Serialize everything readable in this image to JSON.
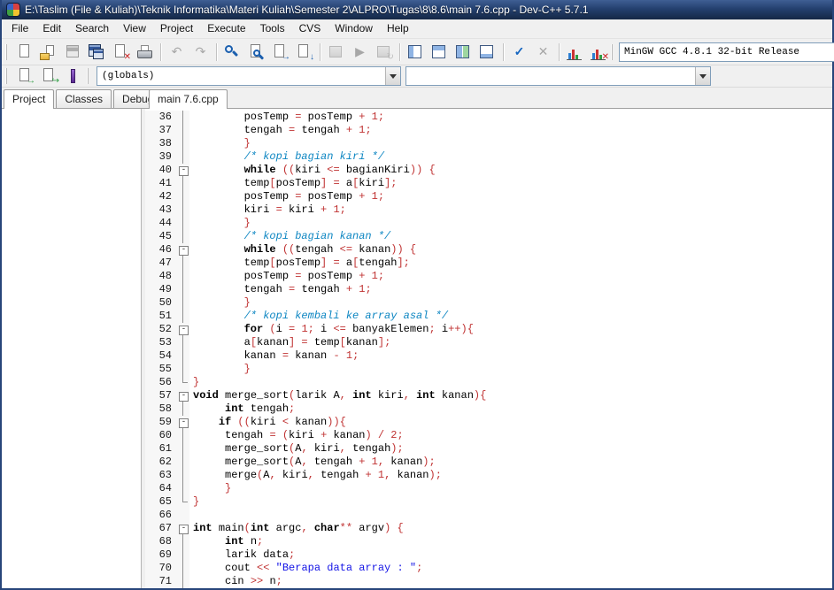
{
  "window": {
    "title": "E:\\Taslim (File & Kuliah)\\Teknik Informatika\\Materi Kuliah\\Semester 2\\ALPRO\\Tugas\\8\\8.6\\main 7.6.cpp - Dev-C++ 5.7.1"
  },
  "menu": {
    "items": [
      "File",
      "Edit",
      "Search",
      "View",
      "Project",
      "Execute",
      "Tools",
      "CVS",
      "Window",
      "Help"
    ]
  },
  "toolbars": {
    "main": {
      "groups": [
        [
          {
            "name": "new-source-file",
            "icon": "new"
          },
          {
            "name": "open-file",
            "icon": "open"
          },
          {
            "name": "save",
            "icon": "save",
            "disabled": true
          },
          {
            "name": "save-all",
            "icon": "saveall"
          },
          {
            "name": "close-file",
            "icon": "close"
          },
          {
            "name": "print",
            "icon": "print"
          }
        ],
        [
          {
            "name": "undo",
            "icon": "undo",
            "disabled": true
          },
          {
            "name": "redo",
            "icon": "redo",
            "disabled": true
          }
        ],
        [
          {
            "name": "find",
            "icon": "find"
          },
          {
            "name": "replace",
            "icon": "replace"
          },
          {
            "name": "incremental-search",
            "icon": "isearch"
          },
          {
            "name": "goto-line",
            "icon": "gotoline"
          }
        ],
        [
          {
            "name": "compile",
            "icon": "compile",
            "disabled": true
          },
          {
            "name": "run",
            "icon": "run",
            "disabled": true
          },
          {
            "name": "rebuild-all",
            "icon": "rebuild",
            "disabled": true
          }
        ],
        [
          {
            "name": "view-project-manager",
            "icon": "grid1"
          },
          {
            "name": "view-report-window",
            "icon": "grid2"
          },
          {
            "name": "view-toolbars",
            "icon": "grid3"
          },
          {
            "name": "view-statusbar",
            "icon": "grid4"
          }
        ],
        [
          {
            "name": "syntax-check",
            "icon": "check"
          },
          {
            "name": "abort-compilation",
            "icon": "abort",
            "disabled": true
          }
        ],
        [
          {
            "name": "profile-analysis",
            "icon": "chart"
          },
          {
            "name": "delete-profiling-data",
            "icon": "chartdel"
          }
        ]
      ],
      "compiler_combo": "MinGW GCC 4.8.1 32-bit Release"
    },
    "browser": {
      "groups": [
        [
          {
            "name": "goto-declaration",
            "icon": "decl"
          },
          {
            "name": "goto-implementation",
            "icon": "impl"
          },
          {
            "name": "toggle-bookmark",
            "icon": "bookmark"
          }
        ]
      ],
      "scope_combo": "(globals)",
      "member_combo": ""
    }
  },
  "panel": {
    "tabs": [
      "Project",
      "Classes",
      "Debug"
    ],
    "active_index": 0
  },
  "editor": {
    "tab": "main 7.6.cpp",
    "colors": {
      "keyword": "#000000",
      "symbol": "#c03333",
      "number": "#c03333",
      "comment": "#0d86c2",
      "string": "#1414e6"
    },
    "lines": [
      {
        "n": 36,
        "f": "line",
        "ind": 8,
        "t": [
          [
            "i",
            "posTemp "
          ],
          [
            "s",
            "= "
          ],
          [
            "i",
            "posTemp "
          ],
          [
            "s",
            "+ "
          ],
          [
            "n",
            "1"
          ],
          [
            "s",
            ";"
          ]
        ]
      },
      {
        "n": 37,
        "f": "line",
        "ind": 8,
        "t": [
          [
            "i",
            "tengah "
          ],
          [
            "s",
            "= "
          ],
          [
            "i",
            "tengah "
          ],
          [
            "s",
            "+ "
          ],
          [
            "n",
            "1"
          ],
          [
            "s",
            ";"
          ]
        ]
      },
      {
        "n": 38,
        "f": "line",
        "ind": 8,
        "t": [
          [
            "s",
            "}"
          ]
        ]
      },
      {
        "n": 39,
        "f": "line",
        "ind": 8,
        "t": [
          [
            "c",
            "/* kopi bagian kiri */"
          ]
        ]
      },
      {
        "n": 40,
        "f": "box",
        "ind": 8,
        "t": [
          [
            "k",
            "while "
          ],
          [
            "s",
            "(("
          ],
          [
            "i",
            "kiri "
          ],
          [
            "s",
            "<= "
          ],
          [
            "i",
            "bagianKiri"
          ],
          [
            "s",
            ")) {"
          ]
        ]
      },
      {
        "n": 41,
        "f": "line",
        "ind": 8,
        "t": [
          [
            "i",
            "temp"
          ],
          [
            "s",
            "["
          ],
          [
            "i",
            "posTemp"
          ],
          [
            "s",
            "] = "
          ],
          [
            "i",
            "a"
          ],
          [
            "s",
            "["
          ],
          [
            "i",
            "kiri"
          ],
          [
            "s",
            "];"
          ]
        ]
      },
      {
        "n": 42,
        "f": "line",
        "ind": 8,
        "t": [
          [
            "i",
            "posTemp "
          ],
          [
            "s",
            "= "
          ],
          [
            "i",
            "posTemp "
          ],
          [
            "s",
            "+ "
          ],
          [
            "n",
            "1"
          ],
          [
            "s",
            ";"
          ]
        ]
      },
      {
        "n": 43,
        "f": "line",
        "ind": 8,
        "t": [
          [
            "i",
            "kiri "
          ],
          [
            "s",
            "= "
          ],
          [
            "i",
            "kiri "
          ],
          [
            "s",
            "+ "
          ],
          [
            "n",
            "1"
          ],
          [
            "s",
            ";"
          ]
        ]
      },
      {
        "n": 44,
        "f": "line",
        "ind": 8,
        "t": [
          [
            "s",
            "}"
          ]
        ]
      },
      {
        "n": 45,
        "f": "line",
        "ind": 8,
        "t": [
          [
            "c",
            "/* kopi bagian kanan */"
          ]
        ]
      },
      {
        "n": 46,
        "f": "box",
        "ind": 8,
        "t": [
          [
            "k",
            "while "
          ],
          [
            "s",
            "(("
          ],
          [
            "i",
            "tengah "
          ],
          [
            "s",
            "<= "
          ],
          [
            "i",
            "kanan"
          ],
          [
            "s",
            ")) {"
          ]
        ]
      },
      {
        "n": 47,
        "f": "line",
        "ind": 8,
        "t": [
          [
            "i",
            "temp"
          ],
          [
            "s",
            "["
          ],
          [
            "i",
            "posTemp"
          ],
          [
            "s",
            "] = "
          ],
          [
            "i",
            "a"
          ],
          [
            "s",
            "["
          ],
          [
            "i",
            "tengah"
          ],
          [
            "s",
            "];"
          ]
        ]
      },
      {
        "n": 48,
        "f": "line",
        "ind": 8,
        "t": [
          [
            "i",
            "posTemp "
          ],
          [
            "s",
            "= "
          ],
          [
            "i",
            "posTemp "
          ],
          [
            "s",
            "+ "
          ],
          [
            "n",
            "1"
          ],
          [
            "s",
            ";"
          ]
        ]
      },
      {
        "n": 49,
        "f": "line",
        "ind": 8,
        "t": [
          [
            "i",
            "tengah "
          ],
          [
            "s",
            "= "
          ],
          [
            "i",
            "tengah "
          ],
          [
            "s",
            "+ "
          ],
          [
            "n",
            "1"
          ],
          [
            "s",
            ";"
          ]
        ]
      },
      {
        "n": 50,
        "f": "line",
        "ind": 8,
        "t": [
          [
            "s",
            "}"
          ]
        ]
      },
      {
        "n": 51,
        "f": "line",
        "ind": 8,
        "t": [
          [
            "c",
            "/* kopi kembali ke array asal */"
          ]
        ]
      },
      {
        "n": 52,
        "f": "box",
        "ind": 8,
        "t": [
          [
            "k",
            "for "
          ],
          [
            "s",
            "("
          ],
          [
            "i",
            "i "
          ],
          [
            "s",
            "= "
          ],
          [
            "n",
            "1"
          ],
          [
            "s",
            "; "
          ],
          [
            "i",
            "i "
          ],
          [
            "s",
            "<= "
          ],
          [
            "i",
            "banyakElemen"
          ],
          [
            "s",
            "; "
          ],
          [
            "i",
            "i"
          ],
          [
            "s",
            "++){"
          ]
        ]
      },
      {
        "n": 53,
        "f": "line",
        "ind": 8,
        "t": [
          [
            "i",
            "a"
          ],
          [
            "s",
            "["
          ],
          [
            "i",
            "kanan"
          ],
          [
            "s",
            "] = "
          ],
          [
            "i",
            "temp"
          ],
          [
            "s",
            "["
          ],
          [
            "i",
            "kanan"
          ],
          [
            "s",
            "];"
          ]
        ]
      },
      {
        "n": 54,
        "f": "line",
        "ind": 8,
        "t": [
          [
            "i",
            "kanan "
          ],
          [
            "s",
            "= "
          ],
          [
            "i",
            "kanan "
          ],
          [
            "s",
            "- "
          ],
          [
            "n",
            "1"
          ],
          [
            "s",
            ";"
          ]
        ]
      },
      {
        "n": 55,
        "f": "line",
        "ind": 8,
        "t": [
          [
            "s",
            "}"
          ]
        ]
      },
      {
        "n": 56,
        "f": "end",
        "ind": 0,
        "t": [
          [
            "s",
            "}"
          ]
        ]
      },
      {
        "n": 57,
        "f": "box",
        "ind": 0,
        "t": [
          [
            "k",
            "void "
          ],
          [
            "i",
            "merge_sort"
          ],
          [
            "s",
            "("
          ],
          [
            "i",
            "larik A"
          ],
          [
            "s",
            ", "
          ],
          [
            "k",
            "int "
          ],
          [
            "i",
            "kiri"
          ],
          [
            "s",
            ", "
          ],
          [
            "k",
            "int "
          ],
          [
            "i",
            "kanan"
          ],
          [
            "s",
            "){"
          ]
        ]
      },
      {
        "n": 58,
        "f": "line",
        "ind": 5,
        "t": [
          [
            "k",
            "int "
          ],
          [
            "i",
            "tengah"
          ],
          [
            "s",
            ";"
          ]
        ]
      },
      {
        "n": 59,
        "f": "box",
        "ind": 4,
        "t": [
          [
            "k",
            "if "
          ],
          [
            "s",
            "(("
          ],
          [
            "i",
            "kiri "
          ],
          [
            "s",
            "< "
          ],
          [
            "i",
            "kanan"
          ],
          [
            "s",
            ")){"
          ]
        ]
      },
      {
        "n": 60,
        "f": "line",
        "ind": 5,
        "t": [
          [
            "i",
            "tengah "
          ],
          [
            "s",
            "= ("
          ],
          [
            "i",
            "kiri "
          ],
          [
            "s",
            "+ "
          ],
          [
            "i",
            "kanan"
          ],
          [
            "s",
            ") / "
          ],
          [
            "n",
            "2"
          ],
          [
            "s",
            ";"
          ]
        ]
      },
      {
        "n": 61,
        "f": "line",
        "ind": 5,
        "t": [
          [
            "i",
            "merge_sort"
          ],
          [
            "s",
            "("
          ],
          [
            "i",
            "A"
          ],
          [
            "s",
            ", "
          ],
          [
            "i",
            "kiri"
          ],
          [
            "s",
            ", "
          ],
          [
            "i",
            "tengah"
          ],
          [
            "s",
            ");"
          ]
        ]
      },
      {
        "n": 62,
        "f": "line",
        "ind": 5,
        "t": [
          [
            "i",
            "merge_sort"
          ],
          [
            "s",
            "("
          ],
          [
            "i",
            "A"
          ],
          [
            "s",
            ", "
          ],
          [
            "i",
            "tengah "
          ],
          [
            "s",
            "+ "
          ],
          [
            "n",
            "1"
          ],
          [
            "s",
            ", "
          ],
          [
            "i",
            "kanan"
          ],
          [
            "s",
            ");"
          ]
        ]
      },
      {
        "n": 63,
        "f": "line",
        "ind": 5,
        "t": [
          [
            "i",
            "merge"
          ],
          [
            "s",
            "("
          ],
          [
            "i",
            "A"
          ],
          [
            "s",
            ", "
          ],
          [
            "i",
            "kiri"
          ],
          [
            "s",
            ", "
          ],
          [
            "i",
            "tengah "
          ],
          [
            "s",
            "+ "
          ],
          [
            "n",
            "1"
          ],
          [
            "s",
            ", "
          ],
          [
            "i",
            "kanan"
          ],
          [
            "s",
            ");"
          ]
        ]
      },
      {
        "n": 64,
        "f": "line",
        "ind": 5,
        "t": [
          [
            "s",
            "}"
          ]
        ]
      },
      {
        "n": 65,
        "f": "end",
        "ind": 0,
        "t": [
          [
            "s",
            "}"
          ]
        ]
      },
      {
        "n": 66,
        "f": "none",
        "ind": 0,
        "t": []
      },
      {
        "n": 67,
        "f": "box",
        "ind": 0,
        "t": [
          [
            "k",
            "int "
          ],
          [
            "i",
            "main"
          ],
          [
            "s",
            "("
          ],
          [
            "k",
            "int "
          ],
          [
            "i",
            "argc"
          ],
          [
            "s",
            ", "
          ],
          [
            "k",
            "char"
          ],
          [
            "s",
            "** "
          ],
          [
            "i",
            "argv"
          ],
          [
            "s",
            ") {"
          ]
        ]
      },
      {
        "n": 68,
        "f": "line",
        "ind": 5,
        "t": [
          [
            "k",
            "int "
          ],
          [
            "i",
            "n"
          ],
          [
            "s",
            ";"
          ]
        ]
      },
      {
        "n": 69,
        "f": "line",
        "ind": 5,
        "t": [
          [
            "i",
            "larik data"
          ],
          [
            "s",
            ";"
          ]
        ]
      },
      {
        "n": 70,
        "f": "line",
        "ind": 5,
        "t": [
          [
            "i",
            "cout "
          ],
          [
            "s",
            "<< "
          ],
          [
            "q",
            "\"Berapa data array : \""
          ],
          [
            "s",
            ";"
          ]
        ]
      },
      {
        "n": 71,
        "f": "line",
        "ind": 5,
        "t": [
          [
            "i",
            "cin "
          ],
          [
            "s",
            ">> "
          ],
          [
            "i",
            "n"
          ],
          [
            "s",
            ";"
          ]
        ]
      }
    ]
  }
}
